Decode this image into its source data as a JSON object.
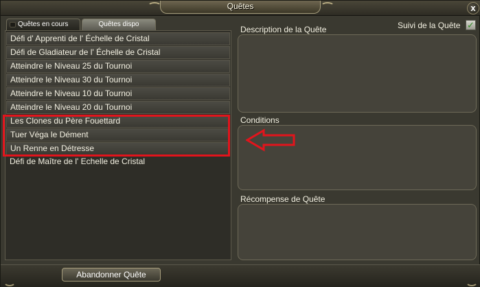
{
  "window": {
    "title": "Quêtes",
    "close_label": "x"
  },
  "tabs": [
    {
      "label": "Quêtes en cours",
      "active": false
    },
    {
      "label": "Quêtes dispo",
      "active": true
    }
  ],
  "quests": [
    {
      "label": "Défi d' Apprenti de l' Échelle de Cristal"
    },
    {
      "label": "Défi de Gladiateur de l' Échelle de Cristal"
    },
    {
      "label": "Atteindre le Niveau 25 du Tournoi"
    },
    {
      "label": "Atteindre le Niveau 30 du Tournoi"
    },
    {
      "label": "Atteindre le Niveau 10 du Tournoi"
    },
    {
      "label": "Atteindre le Niveau 20 du Tournoi"
    },
    {
      "label": "Les Clones du Père Fouettard"
    },
    {
      "label": "Tuer Véga le Dément"
    },
    {
      "label": "Un Renne en Détresse"
    },
    {
      "label": "Défi de Maître de l' Echelle de Cristal"
    }
  ],
  "details": {
    "description_label": "Description de la Quête",
    "conditions_label": "Conditions",
    "reward_label": "Récompense de Quête",
    "follow_label": "Suivi de la Quête",
    "follow_checked": true,
    "check_mark": "✓"
  },
  "actions": {
    "abandon_label": "Abandonner Quête"
  },
  "annotation_colors": {
    "highlight": "#e2141c"
  }
}
